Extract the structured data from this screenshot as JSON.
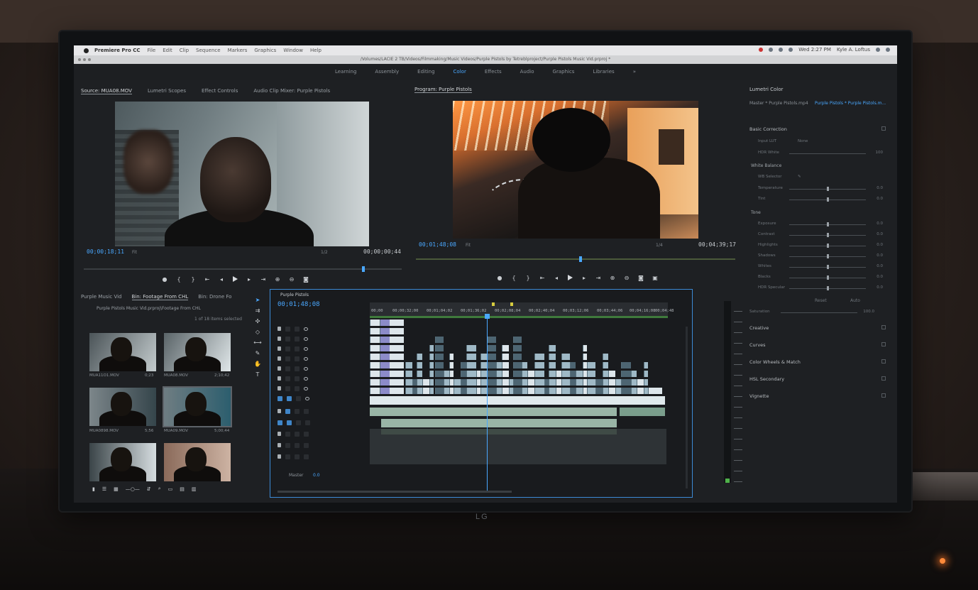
{
  "app": {
    "name": "Premiere Pro CC",
    "menus": [
      "File",
      "Edit",
      "Clip",
      "Sequence",
      "Markers",
      "Graphics",
      "Window",
      "Help"
    ],
    "clock": "Wed 2:27 PM",
    "user": "Kyle A. Loftus",
    "title_path": "/Volumes/LACIE 2 TB/Videos/Filmmaking/Music Videos/Purple Pistols by Tetreblproject/Purple Pistols Music Vid.prproj *"
  },
  "workspaces": [
    {
      "label": "Learning",
      "active": false
    },
    {
      "label": "Assembly",
      "active": false
    },
    {
      "label": "Editing",
      "active": false
    },
    {
      "label": "Color",
      "active": true
    },
    {
      "label": "Effects",
      "active": false
    },
    {
      "label": "Audio",
      "active": false
    },
    {
      "label": "Graphics",
      "active": false
    },
    {
      "label": "Libraries",
      "active": false
    },
    {
      "label": "»",
      "active": false
    }
  ],
  "source_monitor": {
    "tabs": [
      "Source: MUA08.MOV",
      "Lumetri Scopes",
      "Effect Controls",
      "Audio Clip Mixer: Purple Pistols"
    ],
    "timecode": "00;00;18;11",
    "duration": "00;00;00;44",
    "scale": "Fit",
    "resolution": "1/2"
  },
  "program_monitor": {
    "tab": "Program: Purple Pistols",
    "timecode": "00;01;48;08",
    "duration": "00;04;39;17",
    "scale": "Fit",
    "resolution": "1/4"
  },
  "project": {
    "tabs": [
      "Purple Music Vid",
      "Bin: Footage From CHL",
      "Bin: Drone Fo"
    ],
    "path": "Purple Pistols Music Vid.prproj\\Footage From CHL",
    "count": "1 of 18 items selected",
    "clips": [
      {
        "name": "MUA11O1.MOV",
        "duration": "0;23"
      },
      {
        "name": "MUA08.MOV",
        "duration": "2;10;42"
      },
      {
        "name": "MUA0898.MOV",
        "duration": "5;56"
      },
      {
        "name": "MUA09.MOV",
        "duration": "5;00;44"
      },
      {
        "name": "",
        "duration": ""
      },
      {
        "name": "",
        "duration": ""
      }
    ]
  },
  "timeline": {
    "title": "Purple Pistols",
    "timecode": "00;01;48;08",
    "ruler": [
      "00;00",
      "00;00;32;00",
      "00;01;04;02",
      "00;01;36;02",
      "00;02;08;04",
      "00;02;40;04",
      "00;03;12;06",
      "00;03;44;06",
      "00;04;16;08",
      "00;04;48"
    ],
    "master_label": "Master",
    "master_value": "0.0"
  },
  "lumetri": {
    "title": "Lumetri Color",
    "master": "Master * Purple Pistols.mp4",
    "clip": "Purple Pistols * Purple Pistols.m...",
    "basic_correction": "Basic Correction",
    "input_lut": "Input LUT",
    "input_lut_value": "None",
    "hdr_white": "HDR White",
    "hdr_white_value": "100",
    "white_balance": "White Balance",
    "wb_selector": "WB Selector",
    "wb_rows": [
      {
        "label": "Temperature",
        "value": "0.0",
        "pos": 0.5
      },
      {
        "label": "Tint",
        "value": "0.0",
        "pos": 0.5
      }
    ],
    "tone": "Tone",
    "tone_rows": [
      {
        "label": "Exposure",
        "value": "0.0",
        "pos": 0.5
      },
      {
        "label": "Contrast",
        "value": "0.0",
        "pos": 0.5
      },
      {
        "label": "Highlights",
        "value": "0.0",
        "pos": 0.5
      },
      {
        "label": "Shadows",
        "value": "0.0",
        "pos": 0.5
      },
      {
        "label": "Whites",
        "value": "0.0",
        "pos": 0.5
      },
      {
        "label": "Blacks",
        "value": "0.0",
        "pos": 0.5
      },
      {
        "label": "HDR Specular",
        "value": "0.0",
        "pos": 0.5
      }
    ],
    "reset": "Reset",
    "auto": "Auto",
    "saturation": "Saturation",
    "saturation_value": "100.0",
    "sections": [
      "Creative",
      "Curves",
      "Color Wheels & Match",
      "HSL Secondary",
      "Vignette"
    ]
  },
  "brand": "LG"
}
